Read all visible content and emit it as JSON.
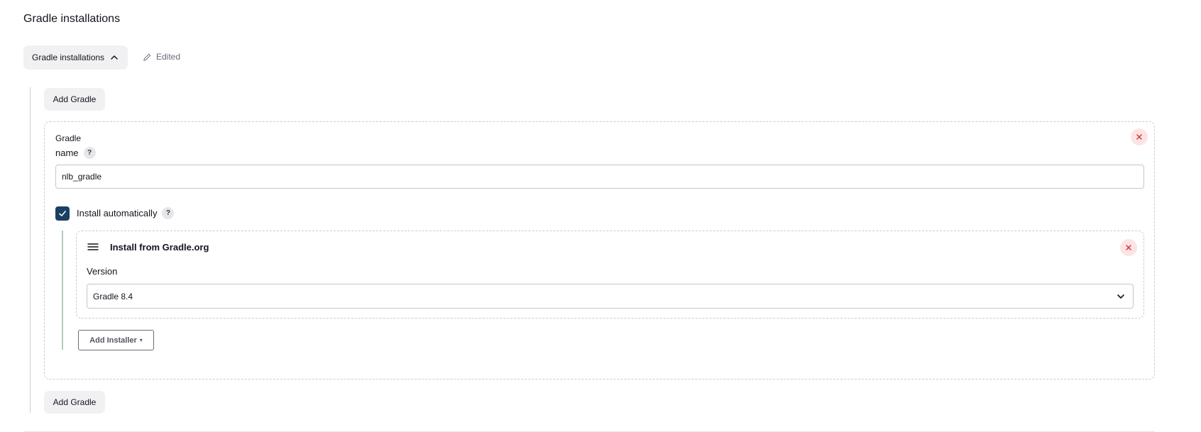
{
  "section": {
    "title": "Gradle installations"
  },
  "toggle": {
    "label": "Gradle installations"
  },
  "status": {
    "edited_label": "Edited"
  },
  "buttons": {
    "add_gradle_top": "Add Gradle",
    "add_gradle_bottom": "Add Gradle",
    "add_installer": "Add Installer",
    "add_installer_caret": "▾"
  },
  "installation": {
    "heading": "Gradle",
    "name_label": "name",
    "name_help": "?",
    "name_value": "nlb_gradle",
    "install_auto_label": "Install automatically",
    "install_auto_help": "?",
    "install_auto_checked": true
  },
  "installer": {
    "title": "Install from Gradle.org",
    "version_label": "Version",
    "version_value": "Gradle 8.4"
  },
  "icons": {
    "toggle": "chevron-up-icon",
    "edited": "pencil-icon",
    "close": "close-icon",
    "drag": "drag-handle-icon",
    "select": "chevron-down-icon",
    "check": "check-icon"
  },
  "colors": {
    "accent": "#1b3f63",
    "danger": "#d63838",
    "danger_bg": "#fde4e4",
    "neutral_bg": "#f1f1f3",
    "rule_green": "#b5cbb9"
  }
}
